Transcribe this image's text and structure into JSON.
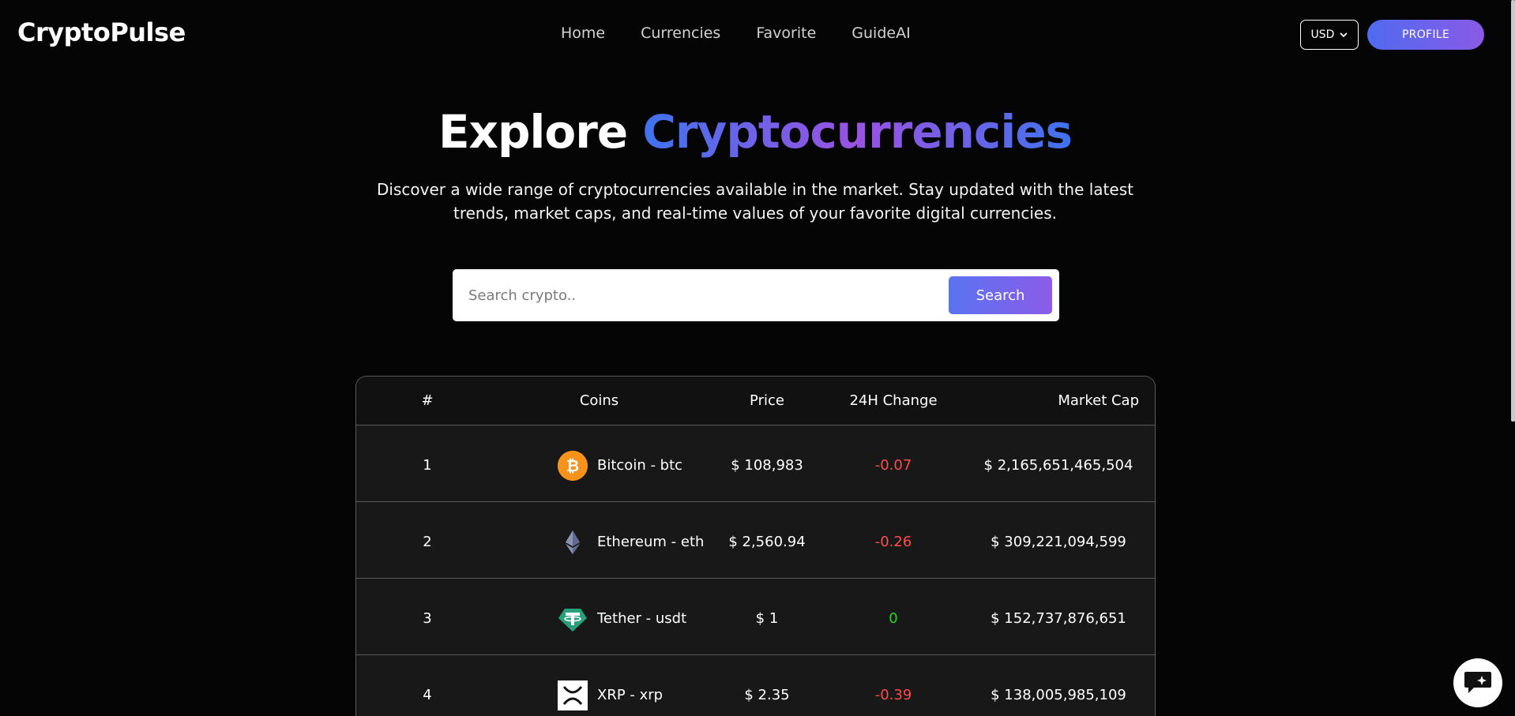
{
  "header": {
    "logo": "CryptoPulse",
    "nav": [
      "Home",
      "Currencies",
      "Favorite",
      "GuideAI"
    ],
    "currency": "USD",
    "profile_label": "PROFILE"
  },
  "hero": {
    "title_plain": "Explore",
    "title_accent": "Cryptocurrencies",
    "description": "Discover a wide range of cryptocurrencies available in the market. Stay updated with the latest trends, market caps, and real-time values of your favorite digital currencies."
  },
  "search": {
    "placeholder": "Search crypto..",
    "button_label": "Search"
  },
  "table": {
    "headers": {
      "rank": "#",
      "coin": "Coins",
      "price": "Price",
      "change": "24H Change",
      "cap": "Market Cap"
    },
    "rows": [
      {
        "rank": "1",
        "name": "Bitcoin - btc",
        "price": "$ 108,983",
        "change": "-0.07",
        "cap": "$ 2,165,651,465,504",
        "icon": "bitcoin-icon",
        "icon_bg": "#f7931a"
      },
      {
        "rank": "2",
        "name": "Ethereum - eth",
        "price": "$ 2,560.94",
        "change": "-0.26",
        "cap": "$ 309,221,094,599",
        "icon": "ethereum-icon",
        "icon_bg": "#181818"
      },
      {
        "rank": "3",
        "name": "Tether - usdt",
        "price": "$ 1",
        "change": "0",
        "cap": "$ 152,737,876,651",
        "icon": "tether-icon",
        "icon_bg": "#26a17b"
      },
      {
        "rank": "4",
        "name": "XRP - xrp",
        "price": "$ 2.35",
        "change": "-0.39",
        "cap": "$ 138,005,985,109",
        "icon": "xrp-icon",
        "icon_bg": "#ffffff"
      }
    ]
  },
  "colors": {
    "background": "#050505",
    "accent_start": "#4f6bf0",
    "accent_end": "#8a5ae6",
    "negative": "#ff4b4b",
    "neutral_change": "#2ad12a"
  }
}
